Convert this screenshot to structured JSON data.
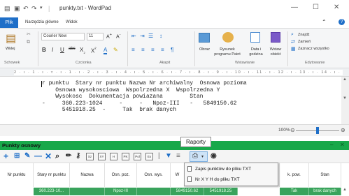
{
  "window": {
    "title": "punkty.txt - WordPad",
    "min_glyph": "—",
    "max_glyph": "☐",
    "close_glyph": "✕"
  },
  "ribbon_tabs": {
    "file": "Plik",
    "home": "Narzędzia główne",
    "view": "Widok"
  },
  "ribbon": {
    "paste_label": "Wklej",
    "font_name": "Courier New",
    "font_size": "11",
    "picture_label": "Obraz",
    "paint_label": "Rysunek programu Paint",
    "datetime_label": "Data i godzina",
    "object_label": "Wstaw obiekt",
    "find_label": "Znajdź",
    "replace_label": "Zamień",
    "select_all_label": "Zaznacz wszystko",
    "groups": {
      "clipboard": "Schowek",
      "font": "Czcionka",
      "paragraph": "Akapit",
      "insert": "Wstawianie",
      "editing": "Edytowanie"
    }
  },
  "ruler": {
    "text": "2 · ı · 1 · ı · ▿ · ı · 1 · ı · 2 · ı · 3 · ı · 4 · ı · 5 · ı · 6 · ı · 7 · ı · 8 · ı · 9 · ı · 10 · ı · 11 · ı · 12 · ı · 13 · ı · 14 · ı · 15 · ı △ 16 · ı · 17 · ı"
  },
  "document": {
    "lines": [
      "r punktu  Stary nr punktu Nazwa Nr archiwalny  Osnowa pozioma",
      "    Osnowa wysokosciowa  Wspolrzedna X  Wspolrzedna Y",
      "    Wysokosc  Dokumentacja powiazana        Stan",
      "-     360.223-1024     -     -   Npoz-III   -   5849150.62",
      "      5451918.25  -     Tak  brak danych"
    ]
  },
  "statusbar": {
    "zoom": "100%",
    "zoom_level": 0.5
  },
  "panel": {
    "title": "Punkty osnowy",
    "tooltip": "Raporty",
    "toolbar_boxes": [
      "Sz",
      "XY",
      "H",
      "PK",
      "Pol",
      "Ex"
    ]
  },
  "menu": {
    "items": [
      "Zapis punktów do pliku TXT",
      "Nr X Y H do pliku TXT"
    ]
  },
  "grid": {
    "headers": [
      "Nr punktu",
      "Stary nr punktu",
      "Nazwa",
      "Osn. poz.",
      "Osn. wys.",
      "W",
      "",
      "k. pow.",
      "Stan"
    ],
    "row": [
      "",
      "360.223-10...",
      "",
      "Npoz-III",
      "",
      "5849150.62",
      "5451918.25",
      "Tak",
      "brak danych"
    ]
  },
  "colors": {
    "accent": "#1f6fc8",
    "panel_green": "#18a84a",
    "row_green": "#39a35c"
  }
}
